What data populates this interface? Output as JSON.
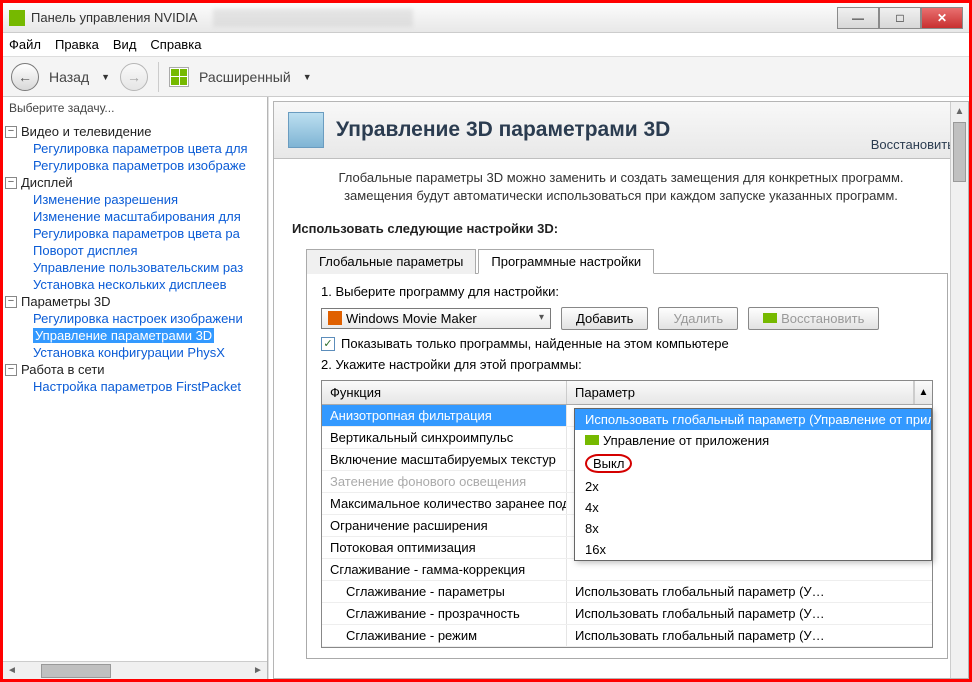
{
  "window": {
    "title": "Панель управления NVIDIA"
  },
  "menu": {
    "file": "Файл",
    "edit": "Правка",
    "view": "Вид",
    "help": "Справка"
  },
  "toolbar": {
    "back": "Назад",
    "mode": "Расширенный"
  },
  "sidebar": {
    "title": "Выберите задачу...",
    "groups": [
      {
        "label": "Видео и телевидение",
        "items": [
          "Регулировка параметров цвета для",
          "Регулировка параметров изображе"
        ]
      },
      {
        "label": "Дисплей",
        "items": [
          "Изменение разрешения",
          "Изменение масштабирования для",
          "Регулировка параметров цвета ра",
          "Поворот дисплея",
          "Управление пользовательским раз",
          "Установка нескольких дисплеев"
        ]
      },
      {
        "label": "Параметры 3D",
        "items": [
          "Регулировка настроек изображени",
          "Управление параметрами 3D",
          "Установка конфигурации PhysX"
        ],
        "selected": 1
      },
      {
        "label": "Работа в сети",
        "items": [
          "Настройка параметров FirstPacket"
        ]
      }
    ]
  },
  "page": {
    "title": "Управление 3D параметрами 3D",
    "restore": "Восстановить",
    "desc1": "Глобальные параметры 3D можно заменить и создать замещения для конкретных программ.",
    "desc2": "замещения будут автоматически использоваться при каждом запуске указанных программ.",
    "settings_heading": "Использовать следующие настройки 3D:",
    "tabs": {
      "global": "Глобальные параметры",
      "program": "Программные настройки"
    },
    "step1": "1. Выберите программу для настройки:",
    "program": "Windows Movie Maker",
    "buttons": {
      "add": "Добавить",
      "remove": "Удалить",
      "restore": "Восстановить"
    },
    "checkbox": "Показывать только программы, найденные на этом компьютере",
    "step2": "2. Укажите настройки для этой программы:",
    "table": {
      "col1": "Функция",
      "col2": "Параметр",
      "rows": [
        {
          "f": "Анизотропная фильтрация",
          "p": "Использовать глобальный параметр (Уп",
          "sel": true
        },
        {
          "f": "Вертикальный синхроимпульс",
          "p": ""
        },
        {
          "f": "Включение масштабируемых текстур",
          "p": ""
        },
        {
          "f": "Затенение фонового освещения",
          "p": "",
          "disabled": true
        },
        {
          "f": "Максимальное количество заранее под…",
          "p": ""
        },
        {
          "f": "Ограничение расширения",
          "p": ""
        },
        {
          "f": "Потоковая оптимизация",
          "p": ""
        },
        {
          "f": "Сглаживание - гамма-коррекция",
          "p": ""
        },
        {
          "f": "Сглаживание - параметры",
          "p": "Использовать глобальный параметр (У…",
          "indent": true
        },
        {
          "f": "Сглаживание - прозрачность",
          "p": "Использовать глобальный параметр (У…",
          "indent": true
        },
        {
          "f": "Сглаживание - режим",
          "p": "Использовать глобальный параметр (У…",
          "indent": true
        }
      ]
    },
    "dropdown": {
      "items": [
        {
          "t": "Использовать глобальный параметр (Управление от прило",
          "hi": true
        },
        {
          "t": "Управление от приложения",
          "icon": true
        },
        {
          "t": "Выкл",
          "circled": true
        },
        {
          "t": "2x"
        },
        {
          "t": "4x"
        },
        {
          "t": "8x"
        },
        {
          "t": "16x"
        }
      ]
    }
  }
}
